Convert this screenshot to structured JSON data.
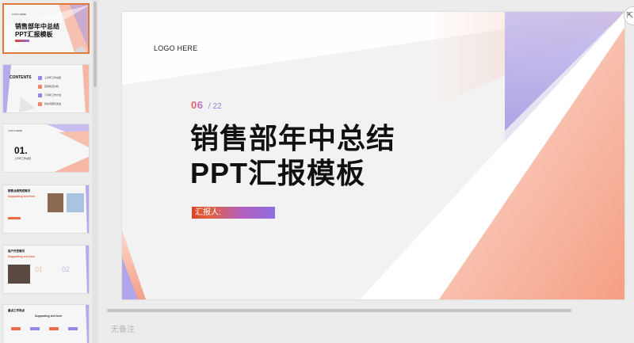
{
  "colors": {
    "accent": "#e07a3c",
    "peach": "#f3a58d",
    "lavender": "#a49be0"
  },
  "slide": {
    "logo": "LOGO HERE",
    "page_current": "06",
    "page_total": "/ 22",
    "title_line1": "销售部年中总结",
    "title_line2": "PPT汇报模板",
    "reporter_label": "汇报人:"
  },
  "thumbnails": [
    {
      "index": 1,
      "title1": "销售部年中总结",
      "title2": "PPT汇报模板"
    },
    {
      "index": 2,
      "title": "CONTENTS",
      "items": [
        "上半年工作总结",
        "完成情况分析",
        "下半年工作计划",
        "存在问题及改进"
      ]
    },
    {
      "index": 3,
      "number": "01.",
      "subtitle": "上半年工作总结"
    },
    {
      "index": 4,
      "heading": "销售业绩完成情况",
      "title": "Supporting text here"
    },
    {
      "index": 5,
      "heading": "客户开发情况",
      "title": "Supporting text here",
      "n1": "01",
      "n2": "02"
    },
    {
      "index": 6,
      "heading": "重点工作亮点",
      "title": "Supporting text here"
    }
  ],
  "notes_placeholder": "无备注",
  "corner_icon": "expand-icon"
}
